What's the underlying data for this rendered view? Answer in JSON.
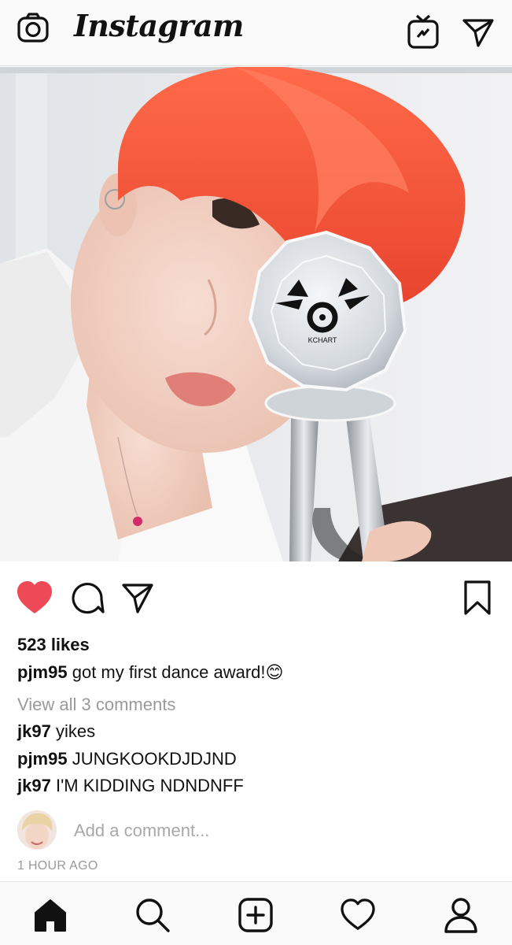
{
  "header": {
    "title": "Instagram",
    "icons": [
      "camera-icon",
      "igtv-icon",
      "direct-message-icon"
    ]
  },
  "post": {
    "likes": "523 likes",
    "caption": {
      "user": "pjm95",
      "text": "got my first dance award!",
      "emoji": "😊"
    },
    "view_all": "View all 3 comments",
    "comments": [
      {
        "user": "jk97",
        "text": "yikes"
      },
      {
        "user": "pjm95",
        "text": "JUNGKOOKDJDJND"
      },
      {
        "user": "jk97",
        "text": "I'M KIDDING NDNDNFF"
      }
    ],
    "add_comment_placeholder": "Add a comment...",
    "timestamp": "1 HOUR AGO",
    "liked": true,
    "like_color": "#ed4956",
    "action_icons": [
      "heart-icon",
      "comment-icon",
      "share-icon",
      "bookmark-icon"
    ]
  },
  "photo": {
    "trophy_logo_text": "KCHART"
  },
  "bottom_nav": {
    "items": [
      "home-icon",
      "search-icon",
      "new-post-icon",
      "activity-icon",
      "profile-icon"
    ]
  }
}
